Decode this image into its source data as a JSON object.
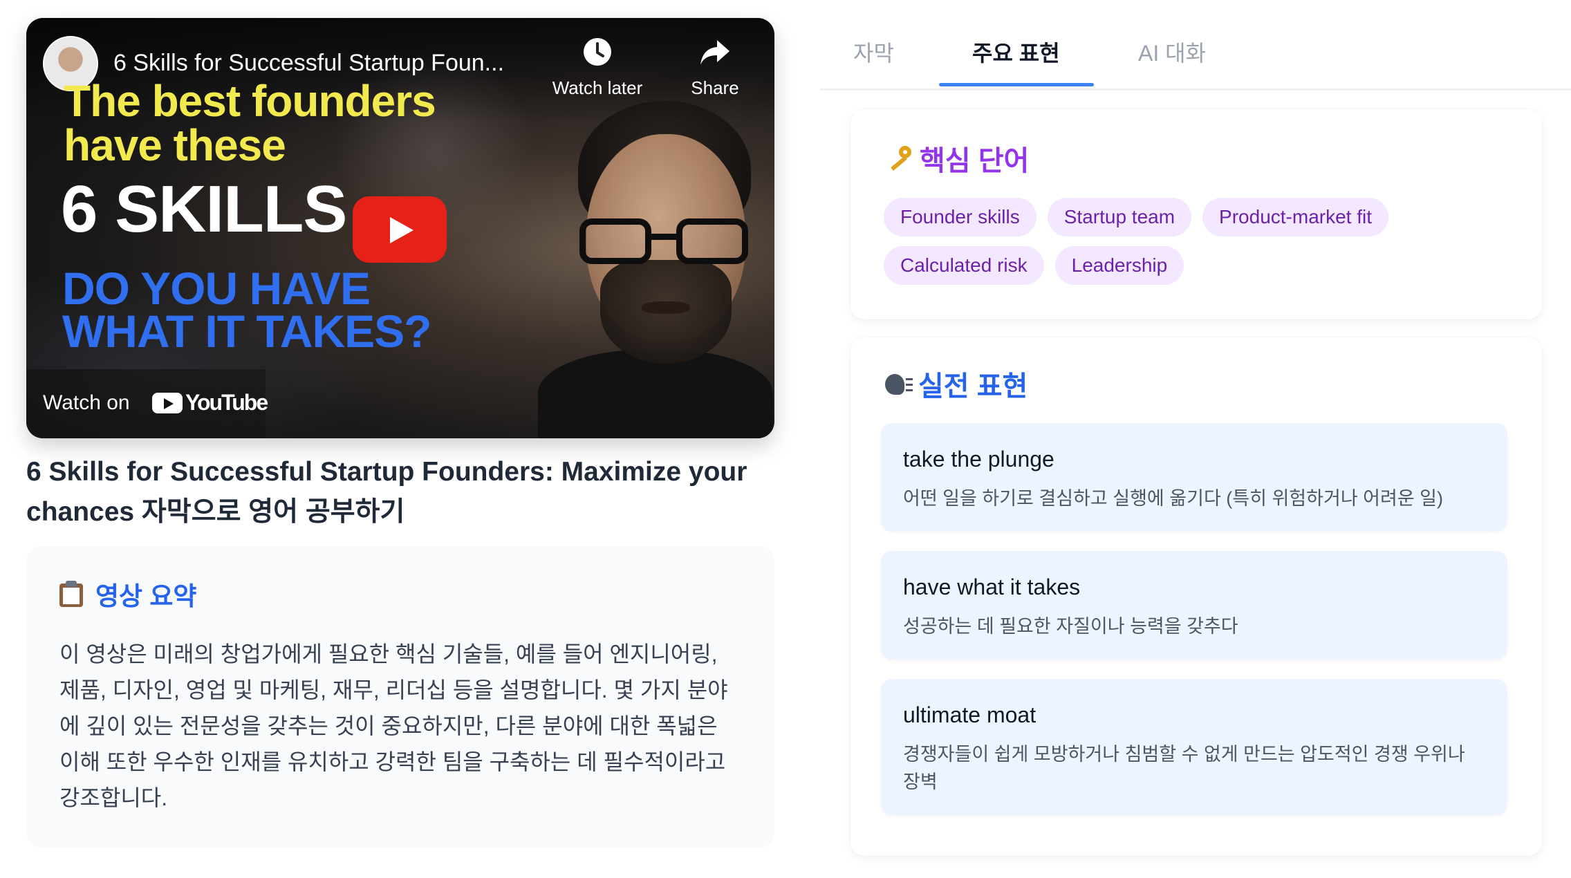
{
  "video": {
    "title": "6 Skills for Successful Startup Foun...",
    "watch_later_label": "Watch later",
    "share_label": "Share",
    "watch_on_label": "Watch on",
    "youtube_logo_text": "YouTube",
    "thumbnail": {
      "line1": "The best founders",
      "line2": "have these",
      "line3": "6 SKILLS",
      "line4": "DO YOU HAVE",
      "line5": "WHAT IT TAKES?"
    }
  },
  "page": {
    "title": "6 Skills for Successful Startup Founders: Maximize your chances 자막으로 영어 공부하기"
  },
  "summary": {
    "heading": "영상 요약",
    "icon": "clipboard-icon",
    "text": "이 영상은 미래의 창업가에게 필요한 핵심 기술들, 예를 들어 엔지니어링, 제품, 디자인, 영업 및 마케팅, 재무, 리더십 등을 설명합니다. 몇 가지 분야에 깊이 있는 전문성을 갖추는 것이 중요하지만, 다른 분야에 대한 폭넓은 이해 또한 우수한 인재를 유치하고 강력한 팀을 구축하는 데 필수적이라고 강조합니다."
  },
  "tabs": [
    {
      "label": "자막",
      "active": false
    },
    {
      "label": "주요 표현",
      "active": true
    },
    {
      "label": "AI 대화",
      "active": false
    }
  ],
  "keywords": {
    "heading": "핵심 단어",
    "icon": "key-icon",
    "items": [
      "Founder skills",
      "Startup team",
      "Product-market fit",
      "Calculated risk",
      "Leadership"
    ]
  },
  "expressions": {
    "heading": "실전 표현",
    "icon": "speaking-head-icon",
    "items": [
      {
        "phrase": "take the plunge",
        "meaning": "어떤 일을 하기로 결심하고 실행에 옮기다 (특히 위험하거나 어려운 일)"
      },
      {
        "phrase": "have what it takes",
        "meaning": "성공하는 데 필요한 자질이나 능력을 갖추다"
      },
      {
        "phrase": "ultimate moat",
        "meaning": "경쟁자들이 쉽게 모방하거나 침범할 수 없게 만드는 압도적인 경쟁 우위나 장벽"
      }
    ]
  },
  "colors": {
    "accent_blue": "#2563eb",
    "keyword_purple": "#9333ea",
    "chip_bg": "#f3e8ff",
    "youtube_red": "#e62117"
  }
}
